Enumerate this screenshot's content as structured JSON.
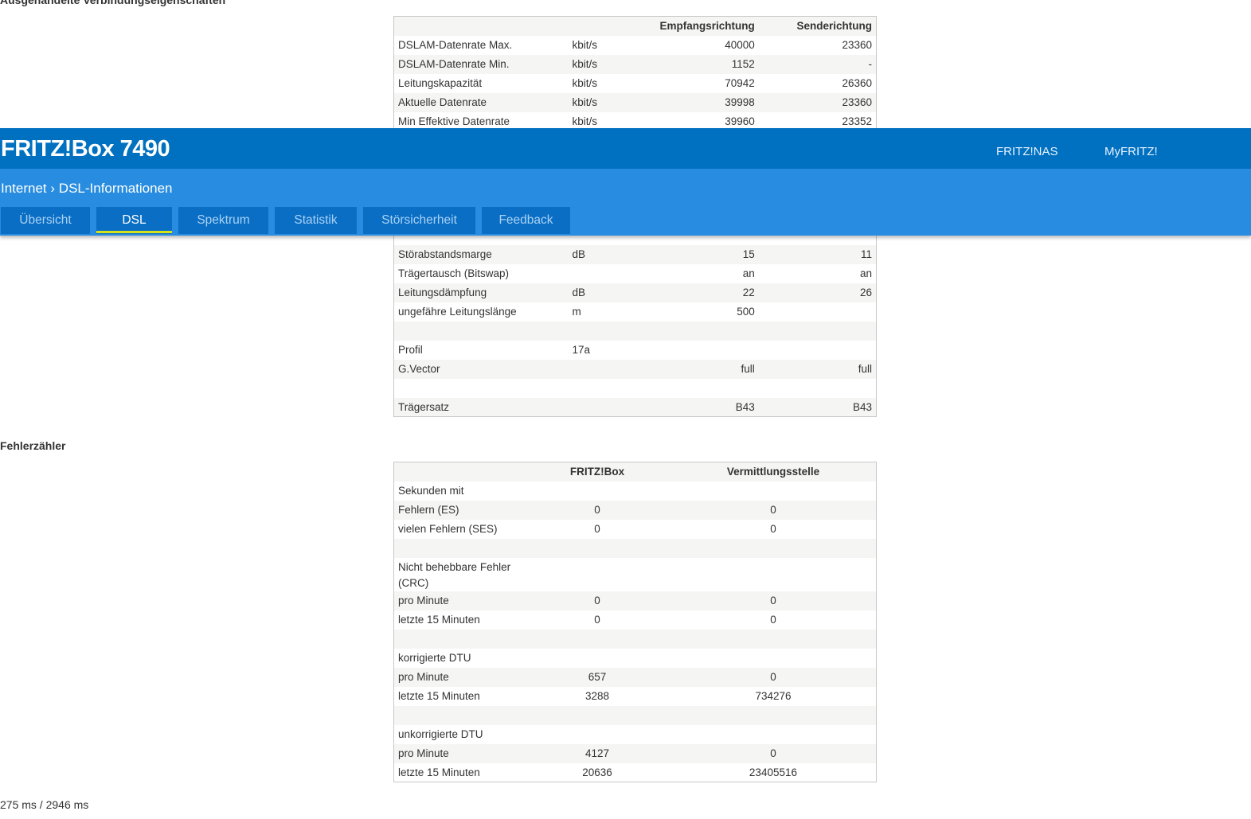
{
  "section1": {
    "title": "Ausgehandelte Verbindungseigenschaften",
    "headers": [
      "",
      "",
      "Empfangsrichtung",
      "Senderichtung"
    ],
    "rows_top": [
      [
        "DSLAM-Datenrate Max.",
        "kbit/s",
        "40000",
        "23360"
      ],
      [
        "DSLAM-Datenrate Min.",
        "kbit/s",
        "1152",
        "-"
      ],
      [
        "Leitungskapazität",
        "kbit/s",
        "70942",
        "26360"
      ],
      [
        "Aktuelle Datenrate",
        "kbit/s",
        "39998",
        "23360"
      ],
      [
        "Min Effektive Datenrate",
        "kbit/s",
        "39960",
        "23352"
      ]
    ],
    "rows_bottom": [
      [
        "Störabstandsmarge",
        "dB",
        "15",
        "11"
      ],
      [
        "Trägertausch (Bitswap)",
        "",
        "an",
        "an"
      ],
      [
        "Leitungsdämpfung",
        "dB",
        "22",
        "26"
      ],
      [
        "ungefähre Leitungslänge",
        "m",
        "500",
        ""
      ],
      [
        "",
        "",
        "",
        ""
      ],
      [
        "Profil",
        "17a",
        "",
        ""
      ],
      [
        "G.Vector",
        "",
        "full",
        "full"
      ],
      [
        "",
        "",
        "",
        ""
      ],
      [
        "Trägersatz",
        "",
        "B43",
        "B43"
      ]
    ]
  },
  "header": {
    "brand": "FRITZ!Box 7490",
    "links": [
      "FRITZ!NAS",
      "MyFRITZ!"
    ],
    "breadcrumb": [
      "Internet",
      "DSL-Informationen"
    ],
    "breadcrumb_sep": "›",
    "tabs": [
      {
        "label": "Übersicht"
      },
      {
        "label": "DSL",
        "active": true
      },
      {
        "label": "Spektrum"
      },
      {
        "label": "Statistik"
      },
      {
        "label": "Störsicherheit"
      },
      {
        "label": "Feedback"
      }
    ],
    "colors": {
      "top": "#0070c0",
      "sub": "#288de0",
      "active_underline": "#d8e21a"
    }
  },
  "section2": {
    "title": "Fehlerzähler",
    "headers": [
      "",
      "FRITZ!Box",
      "Vermittlungsstelle"
    ],
    "rows": [
      [
        "Sekunden mit",
        "",
        ""
      ],
      [
        "Fehlern (ES)",
        "0",
        "0"
      ],
      [
        "vielen Fehlern (SES)",
        "0",
        "0"
      ],
      [
        "",
        "",
        ""
      ],
      [
        "Nicht behebbare Fehler (CRC)",
        "",
        ""
      ],
      [
        "pro Minute",
        "0",
        "0"
      ],
      [
        "letzte 15 Minuten",
        "0",
        "0"
      ],
      [
        "",
        "",
        ""
      ],
      [
        "korrigierte DTU",
        "",
        ""
      ],
      [
        "pro Minute",
        "657",
        "0"
      ],
      [
        "letzte 15 Minuten",
        "3288",
        "734276"
      ],
      [
        "",
        "",
        ""
      ],
      [
        "unkorrigierte DTU",
        "",
        ""
      ],
      [
        "pro Minute",
        "4127",
        "0"
      ],
      [
        "letzte 15 Minuten",
        "20636",
        "23405516"
      ]
    ]
  },
  "footer": {
    "timing": "275 ms / 2946 ms"
  }
}
